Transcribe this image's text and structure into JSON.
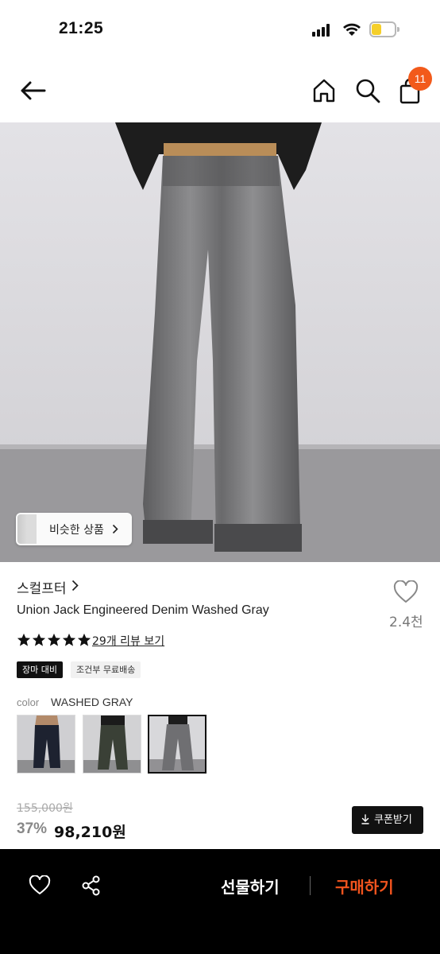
{
  "status_bar": {
    "time": "21:25"
  },
  "nav": {
    "cart_count": "11"
  },
  "image": {
    "similar_label": "비슷한 상품"
  },
  "product": {
    "brand": "스컬프터",
    "title": "Union Jack Engineered Denim Washed Gray",
    "like_count": "2.4천",
    "rating_stars": 5,
    "review_link": "29개 리뷰 보기",
    "tags": [
      "장마 대비",
      "조건부 무료배송"
    ]
  },
  "color": {
    "label": "color",
    "value": "WASHED GRAY",
    "swatches": [
      "dark-black",
      "dark-green",
      "washed-gray"
    ],
    "selected_index": 2
  },
  "price": {
    "original": "155,000원",
    "discount": "37%",
    "sale": "98,210원",
    "coupon": "쿠폰받기"
  },
  "bottom": {
    "gift": "선물하기",
    "buy": "구매하기"
  },
  "colors": {
    "accent": "#f25a1b",
    "buy": "#f2541e"
  }
}
